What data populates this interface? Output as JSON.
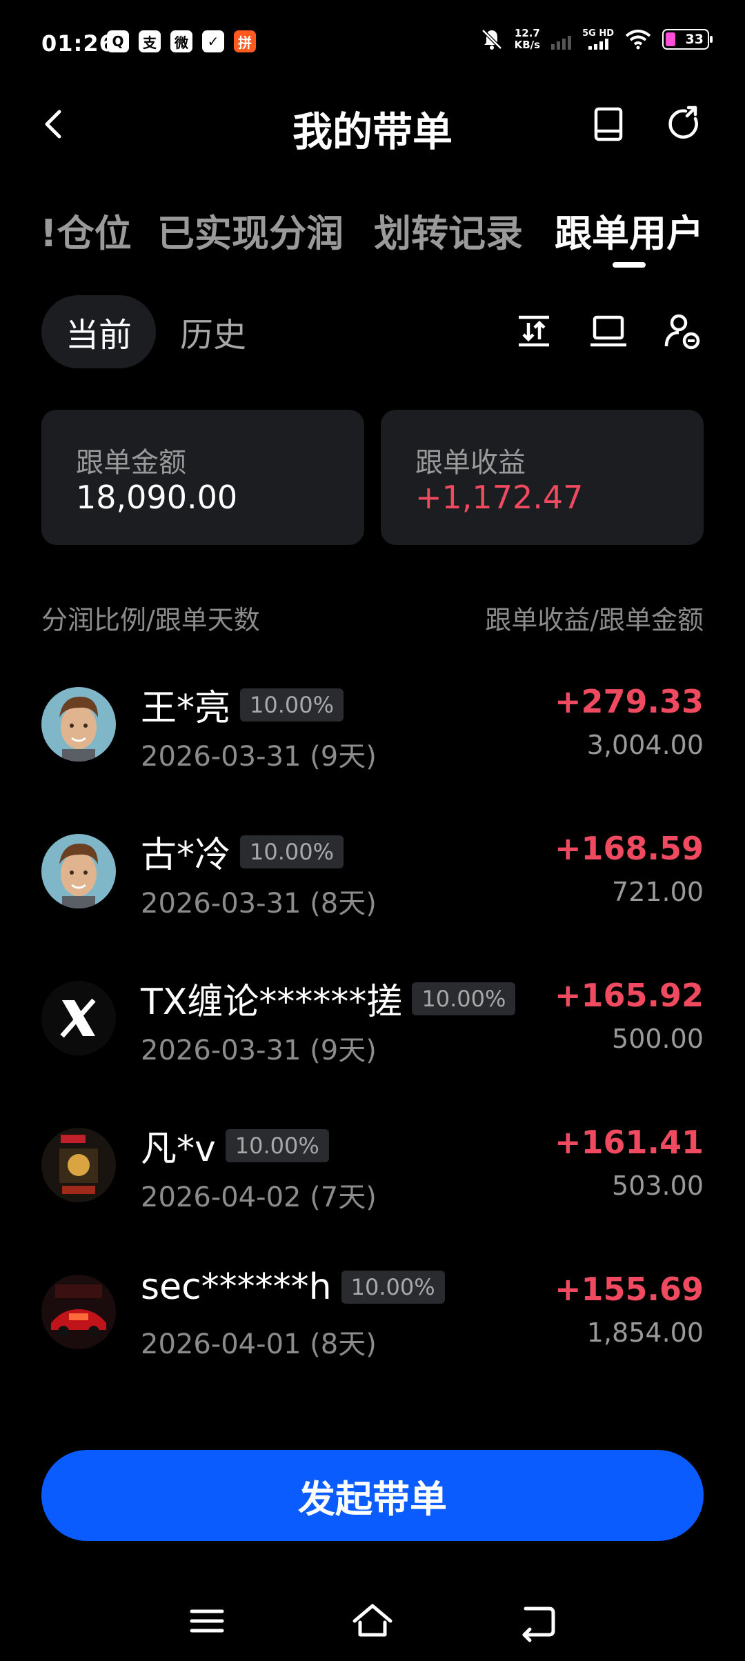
{
  "status_bar": {
    "time": "01:26",
    "apps": [
      "Q",
      "支",
      "微",
      "✓",
      "拼"
    ],
    "speed": "12.7",
    "speed_unit": "KB/s",
    "net": "5G HD",
    "battery": "33"
  },
  "header": {
    "title": "我的带单",
    "icons": [
      "back-arrow-icon",
      "book-icon",
      "refresh-icon"
    ]
  },
  "tabs": [
    {
      "label": "!仓位",
      "active": false
    },
    {
      "label": "已实现分润",
      "active": false
    },
    {
      "label": "划转记录",
      "active": false
    },
    {
      "label": "跟单用户",
      "active": true
    }
  ],
  "segments": {
    "current": "当前",
    "history": "历史"
  },
  "summary": {
    "amount_label": "跟单金额",
    "amount_value": "18,090.00",
    "profit_label": "跟单收益",
    "profit_value": "+1,172.47"
  },
  "list_header": {
    "left": "分润比例/跟单天数",
    "right": "跟单收益/跟单金额"
  },
  "users": [
    {
      "name": "王*亮",
      "ratio": "10.00%",
      "date": "2026-03-31 (9天)",
      "profit": "+279.33",
      "amount": "3,004.00",
      "avatar": "face"
    },
    {
      "name": "古*冷",
      "ratio": "10.00%",
      "date": "2026-03-31 (8天)",
      "profit": "+168.59",
      "amount": "721.00",
      "avatar": "face"
    },
    {
      "name": "TX缠论******搓",
      "ratio": "10.00%",
      "date": "2026-03-31 (9天)",
      "profit": "+165.92",
      "amount": "500.00",
      "avatar": "x-logo"
    },
    {
      "name": "凡*v",
      "ratio": "10.00%",
      "date": "2026-04-02 (7天)",
      "profit": "+161.41",
      "amount": "503.00",
      "avatar": "poster"
    },
    {
      "name": "sec******h",
      "ratio": "10.00%",
      "date": "2026-04-01 (8天)",
      "profit": "+155.69",
      "amount": "1,854.00",
      "avatar": "car"
    }
  ],
  "cta": {
    "label": "发起带单"
  },
  "colors": {
    "accent": "#0a5cff",
    "positive": "#f04a60",
    "card": "#1c1d21",
    "background": "#000000"
  }
}
